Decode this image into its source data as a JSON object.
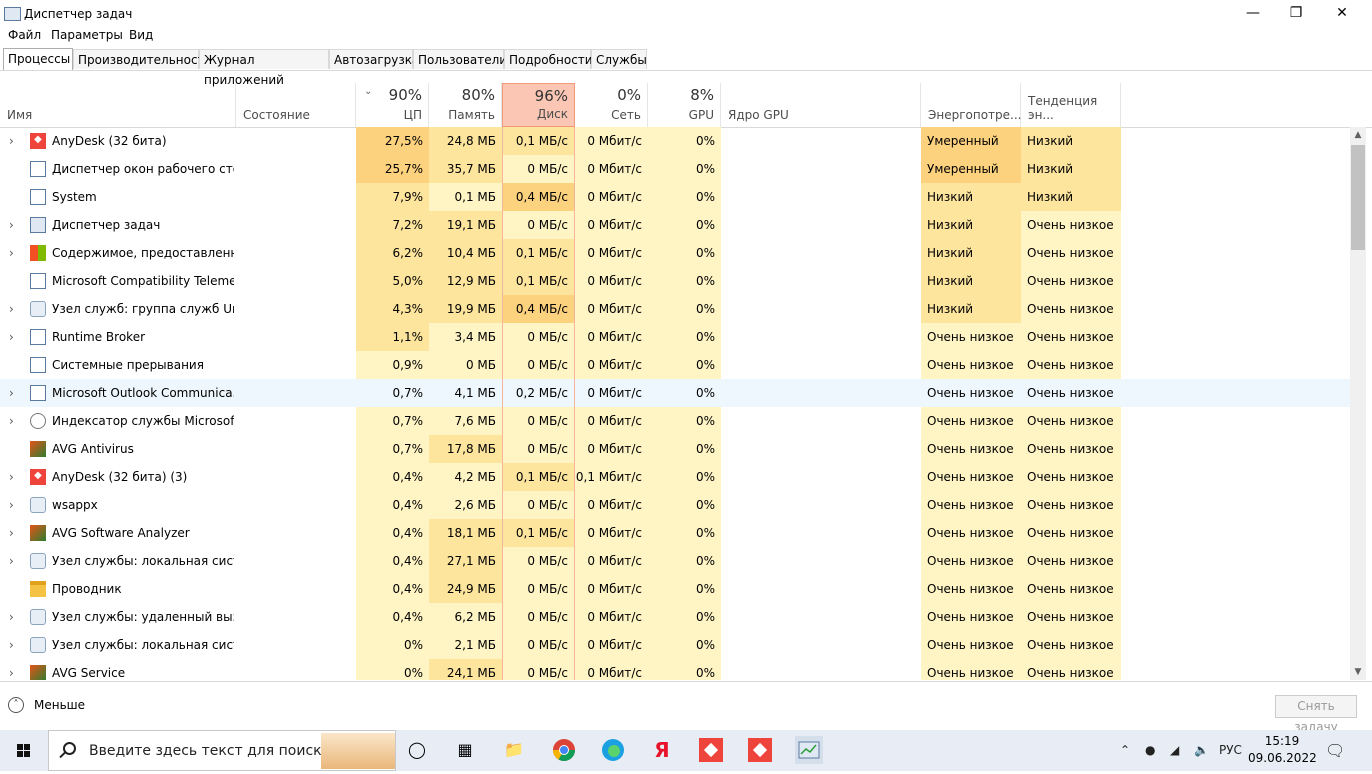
{
  "window": {
    "title": "Диспетчер задач"
  },
  "menu": [
    "Файл",
    "Параметры",
    "Вид"
  ],
  "tabs": [
    "Процессы",
    "Производительность",
    "Журнал приложений",
    "Автозагрузка",
    "Пользователи",
    "Подробности",
    "Службы"
  ],
  "columns": {
    "name": "Имя",
    "status": "Состояние",
    "cpu": {
      "pct": "90%",
      "label": "ЦП"
    },
    "mem": {
      "pct": "80%",
      "label": "Память"
    },
    "disk": {
      "pct": "96%",
      "label": "Диск"
    },
    "net": {
      "pct": "0%",
      "label": "Сеть"
    },
    "gpu": {
      "pct": "8%",
      "label": "GPU"
    },
    "gpu_engine": "Ядро GPU",
    "power": "Энергопотре...",
    "power_trend": "Тенденция эн..."
  },
  "processes": [
    {
      "name": "AnyDesk (32 бита)",
      "exp": true,
      "icon": "anydesk-icon",
      "cpu": "27,5%",
      "mem": "24,8 МБ",
      "disk": "0,1 МБ/с",
      "net": "0 Мбит/с",
      "gpu": "0%",
      "power": "Умеренный",
      "trend": "Низкий"
    },
    {
      "name": "Диспетчер окон рабочего стола",
      "exp": false,
      "icon": "window-icon",
      "cpu": "25,7%",
      "mem": "35,7 МБ",
      "disk": "0 МБ/с",
      "net": "0 Мбит/с",
      "gpu": "0%",
      "power": "Умеренный",
      "trend": "Низкий"
    },
    {
      "name": "System",
      "exp": false,
      "icon": "window-icon",
      "cpu": "7,9%",
      "mem": "0,1 МБ",
      "disk": "0,4 МБ/с",
      "net": "0 Мбит/с",
      "gpu": "0%",
      "power": "Низкий",
      "trend": "Низкий"
    },
    {
      "name": "Диспетчер задач",
      "exp": true,
      "icon": "taskmgr-icon",
      "cpu": "7,2%",
      "mem": "19,1 МБ",
      "disk": "0 МБ/с",
      "net": "0 Мбит/с",
      "gpu": "0%",
      "power": "Низкий",
      "trend": "Очень низкое"
    },
    {
      "name": "Содержимое, предоставленно...",
      "exp": true,
      "icon": "windows-logo-icon",
      "cpu": "6,2%",
      "mem": "10,4 МБ",
      "disk": "0,1 МБ/с",
      "net": "0 Мбит/с",
      "gpu": "0%",
      "power": "Низкий",
      "trend": "Очень низкое"
    },
    {
      "name": "Microsoft Compatibility Teleme...",
      "exp": false,
      "icon": "window-icon",
      "cpu": "5,0%",
      "mem": "12,9 МБ",
      "disk": "0,1 МБ/с",
      "net": "0 Мбит/с",
      "gpu": "0%",
      "power": "Низкий",
      "trend": "Очень низкое"
    },
    {
      "name": "Узел служб: группа служб Uni...",
      "exp": true,
      "icon": "gear-icon",
      "cpu": "4,3%",
      "mem": "19,9 МБ",
      "disk": "0,4 МБ/с",
      "net": "0 Мбит/с",
      "gpu": "0%",
      "power": "Низкий",
      "trend": "Очень низкое"
    },
    {
      "name": "Runtime Broker",
      "exp": true,
      "icon": "window-icon",
      "cpu": "1,1%",
      "mem": "3,4 МБ",
      "disk": "0 МБ/с",
      "net": "0 Мбит/с",
      "gpu": "0%",
      "power": "Очень низкое",
      "trend": "Очень низкое"
    },
    {
      "name": "Системные прерывания",
      "exp": false,
      "icon": "window-icon",
      "cpu": "0,9%",
      "mem": "0 МБ",
      "disk": "0 МБ/с",
      "net": "0 Мбит/с",
      "gpu": "0%",
      "power": "Очень низкое",
      "trend": "Очень низкое"
    },
    {
      "name": "Microsoft Outlook Communica...",
      "exp": true,
      "icon": "window-icon",
      "cpu": "0,7%",
      "mem": "4,1 МБ",
      "disk": "0,2 МБ/с",
      "net": "0 Мбит/с",
      "gpu": "0%",
      "power": "Очень низкое",
      "trend": "Очень низкое",
      "hl": true
    },
    {
      "name": "Индексатор службы Microsoft ...",
      "exp": true,
      "icon": "indexer-icon",
      "cpu": "0,7%",
      "mem": "7,6 МБ",
      "disk": "0 МБ/с",
      "net": "0 Мбит/с",
      "gpu": "0%",
      "power": "Очень низкое",
      "trend": "Очень низкое"
    },
    {
      "name": "AVG Antivirus",
      "exp": false,
      "icon": "avg-icon",
      "cpu": "0,7%",
      "mem": "17,8 МБ",
      "disk": "0 МБ/с",
      "net": "0 Мбит/с",
      "gpu": "0%",
      "power": "Очень низкое",
      "trend": "Очень низкое"
    },
    {
      "name": "AnyDesk (32 бита) (3)",
      "exp": true,
      "icon": "anydesk-icon",
      "cpu": "0,4%",
      "mem": "4,2 МБ",
      "disk": "0,1 МБ/с",
      "net": "0,1 Мбит/с",
      "gpu": "0%",
      "power": "Очень низкое",
      "trend": "Очень низкое"
    },
    {
      "name": "wsappx",
      "exp": true,
      "icon": "gear-icon",
      "cpu": "0,4%",
      "mem": "2,6 МБ",
      "disk": "0 МБ/с",
      "net": "0 Мбит/с",
      "gpu": "0%",
      "power": "Очень низкое",
      "trend": "Очень низкое"
    },
    {
      "name": "AVG Software Analyzer",
      "exp": true,
      "icon": "avg-icon",
      "cpu": "0,4%",
      "mem": "18,1 МБ",
      "disk": "0,1 МБ/с",
      "net": "0 Мбит/с",
      "gpu": "0%",
      "power": "Очень низкое",
      "trend": "Очень низкое"
    },
    {
      "name": "Узел службы: локальная систе...",
      "exp": true,
      "icon": "gear-icon",
      "cpu": "0,4%",
      "mem": "27,1 МБ",
      "disk": "0 МБ/с",
      "net": "0 Мбит/с",
      "gpu": "0%",
      "power": "Очень низкое",
      "trend": "Очень низкое"
    },
    {
      "name": "Проводник",
      "exp": false,
      "icon": "folder-icon",
      "cpu": "0,4%",
      "mem": "24,9 МБ",
      "disk": "0 МБ/с",
      "net": "0 Мбит/с",
      "gpu": "0%",
      "power": "Очень низкое",
      "trend": "Очень низкое"
    },
    {
      "name": "Узел службы: удаленный вызо...",
      "exp": true,
      "icon": "gear-icon",
      "cpu": "0,4%",
      "mem": "6,2 МБ",
      "disk": "0 МБ/с",
      "net": "0 Мбит/с",
      "gpu": "0%",
      "power": "Очень низкое",
      "trend": "Очень низкое"
    },
    {
      "name": "Узел службы: локальная систе...",
      "exp": true,
      "icon": "gear-icon",
      "cpu": "0%",
      "mem": "2,1 МБ",
      "disk": "0 МБ/с",
      "net": "0 Мбит/с",
      "gpu": "0%",
      "power": "Очень низкое",
      "trend": "Очень низкое"
    },
    {
      "name": "AVG Service",
      "exp": true,
      "icon": "avg-icon",
      "cpu": "0%",
      "mem": "24,1 МБ",
      "disk": "0 МБ/с",
      "net": "0 Мбит/с",
      "gpu": "0%",
      "power": "Очень низкое",
      "trend": "Очень низкое"
    }
  ],
  "footer": {
    "less_label": "Меньше",
    "end_task_label": "Снять задачу"
  },
  "taskbar": {
    "search_placeholder": "Введите здесь текст для поиска",
    "language": "РУС",
    "time": "15:19",
    "date": "09.06.2022"
  },
  "colors": {
    "heat_high": "#fdd27f",
    "heat_mid": "#fde59e",
    "heat_low": "#fff4c4",
    "disk_header": "#fbc7b4",
    "row_highlight": "#eef7fd"
  }
}
